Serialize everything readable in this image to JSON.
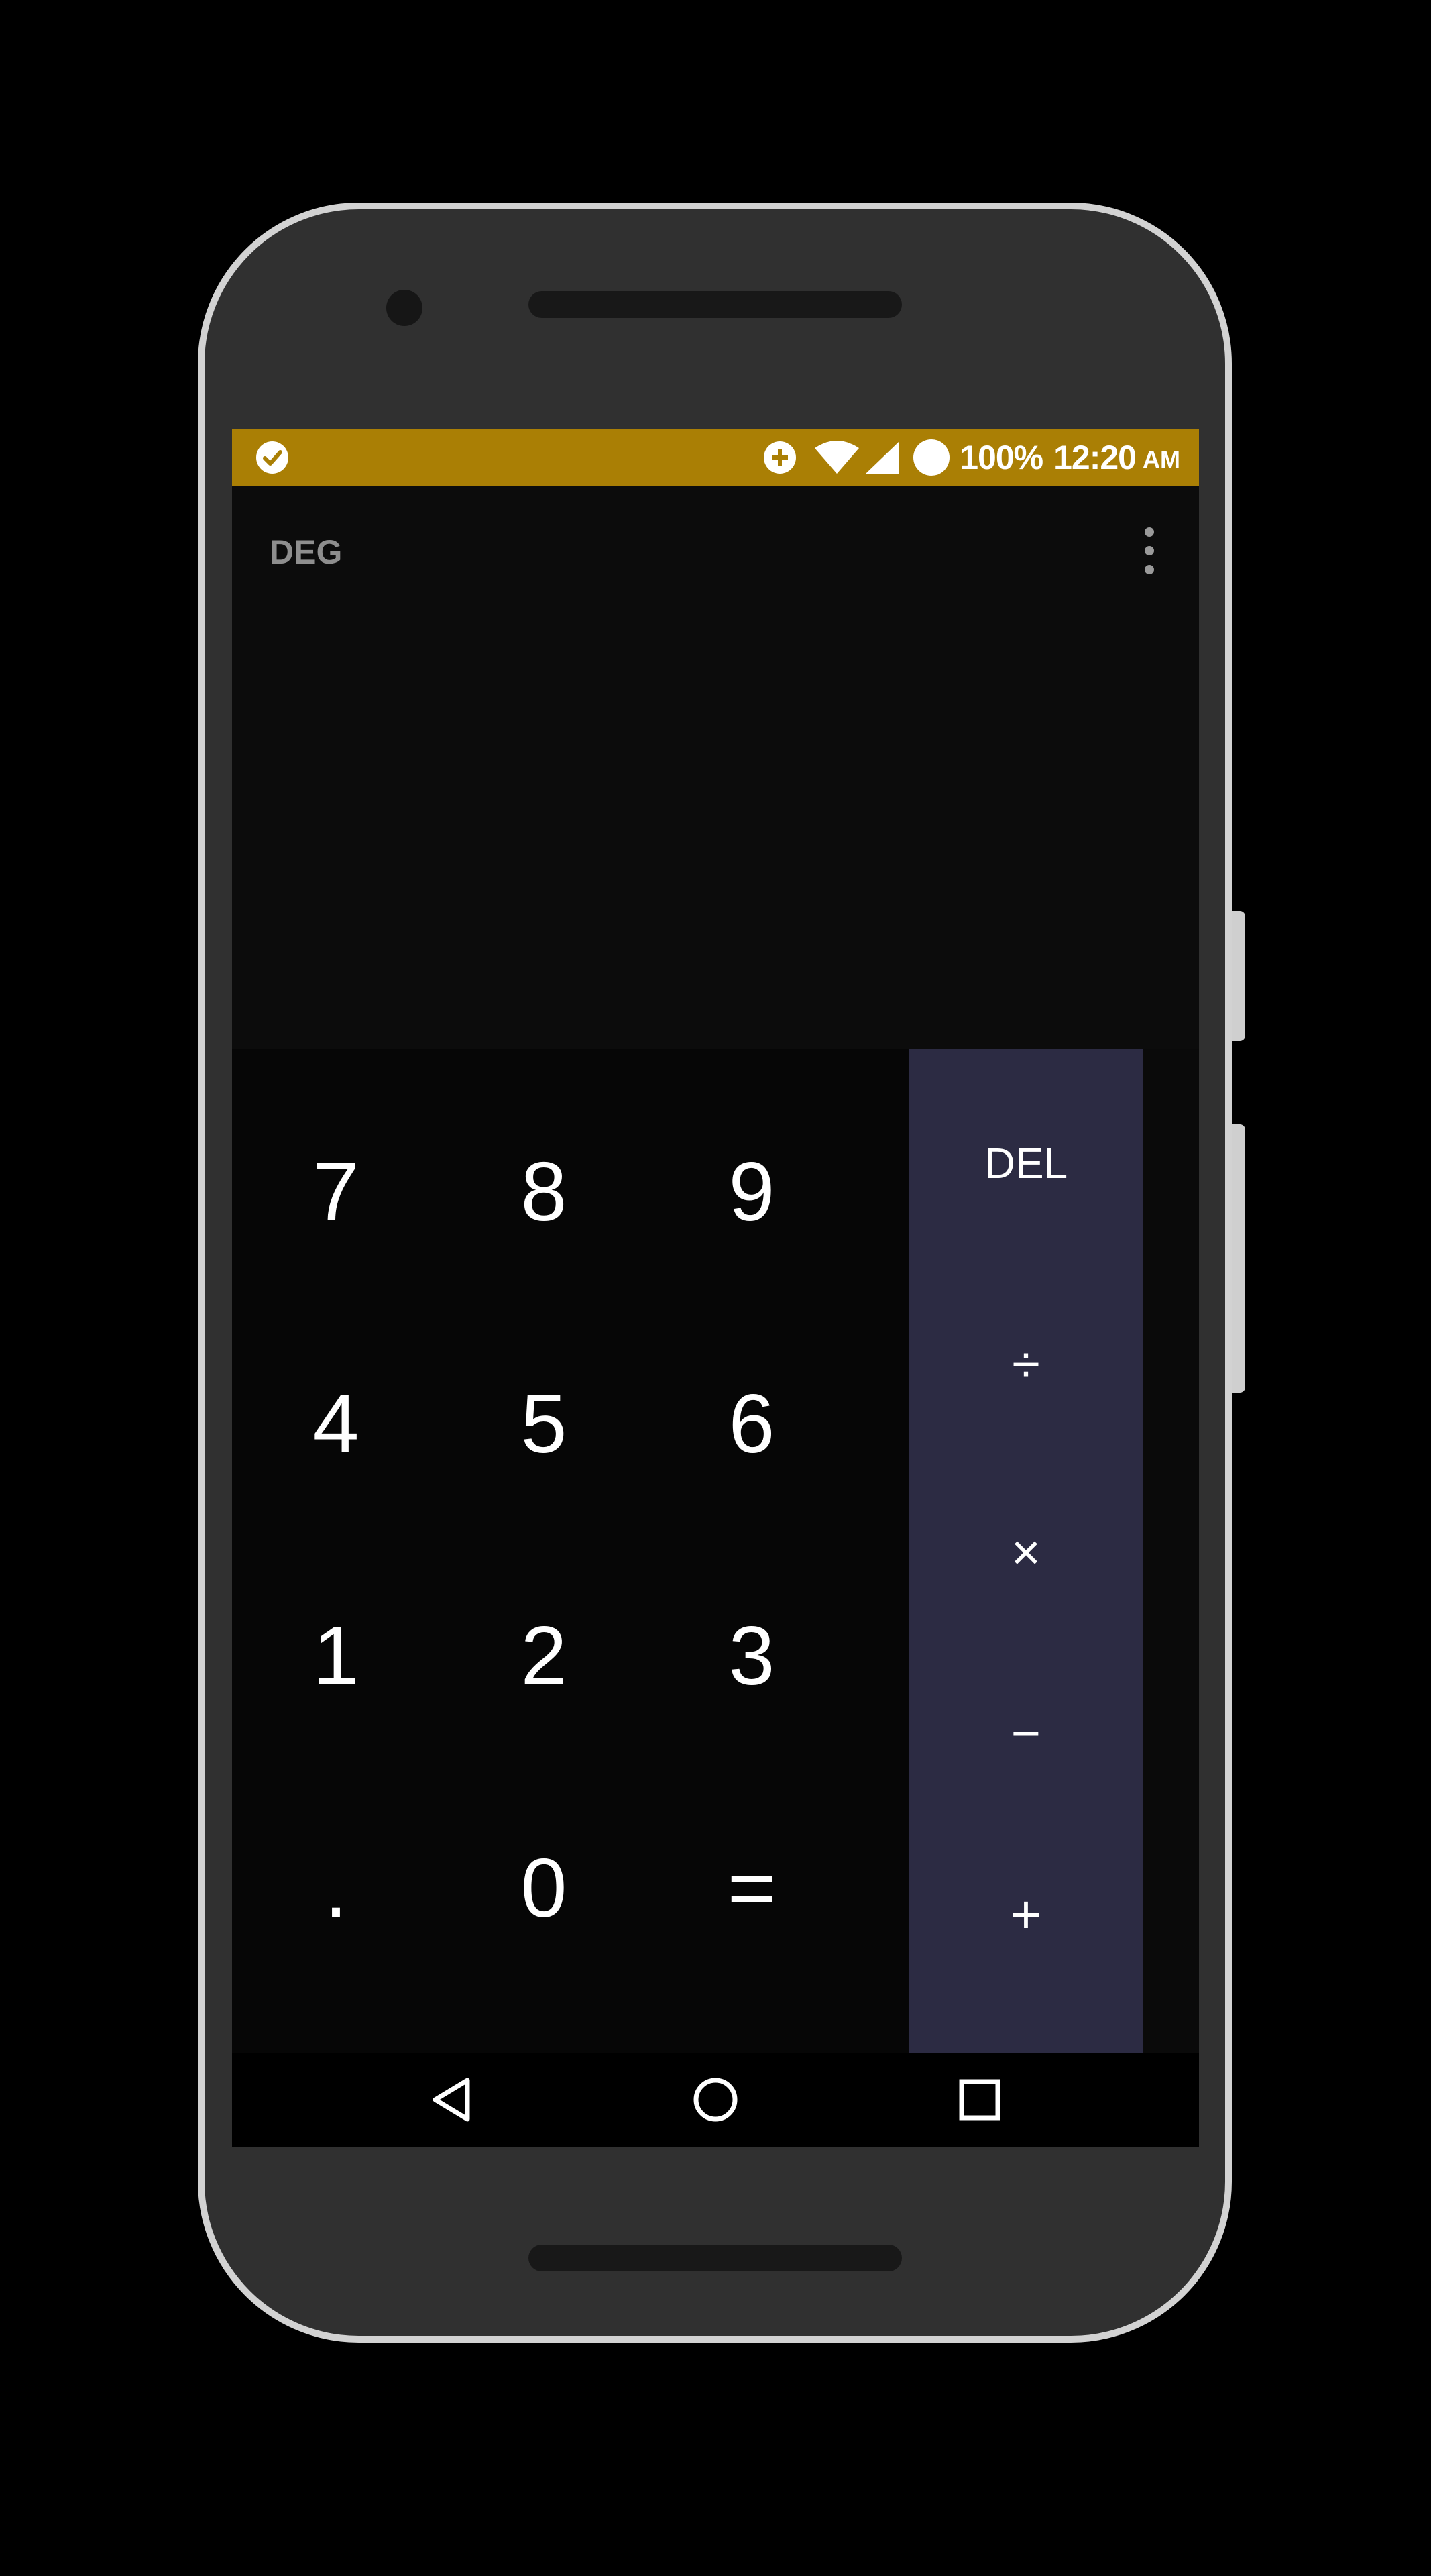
{
  "status_bar": {
    "battery": "100%",
    "time": "12:20",
    "ampm": "AM",
    "background_color": "#aa7f05",
    "icons": [
      "check-circle-icon",
      "data-saver-icon",
      "wifi-icon",
      "cell-signal-icon",
      "battery-circle-icon"
    ]
  },
  "display": {
    "angle_mode": "DEG",
    "menu_icon": "overflow-menu-icon",
    "expression": "",
    "result": ""
  },
  "keypad": {
    "digits": [
      [
        "7",
        "8",
        "9"
      ],
      [
        "4",
        "5",
        "6"
      ],
      [
        "1",
        "2",
        "3"
      ],
      [
        ".",
        "0",
        "="
      ]
    ]
  },
  "operators": {
    "delete": "DEL",
    "divide": "÷",
    "multiply": "×",
    "subtract": "−",
    "add": "+",
    "panel_color": "#2c2b43"
  },
  "nav_bar": {
    "icons": [
      "back-icon",
      "home-icon",
      "recents-icon"
    ]
  }
}
